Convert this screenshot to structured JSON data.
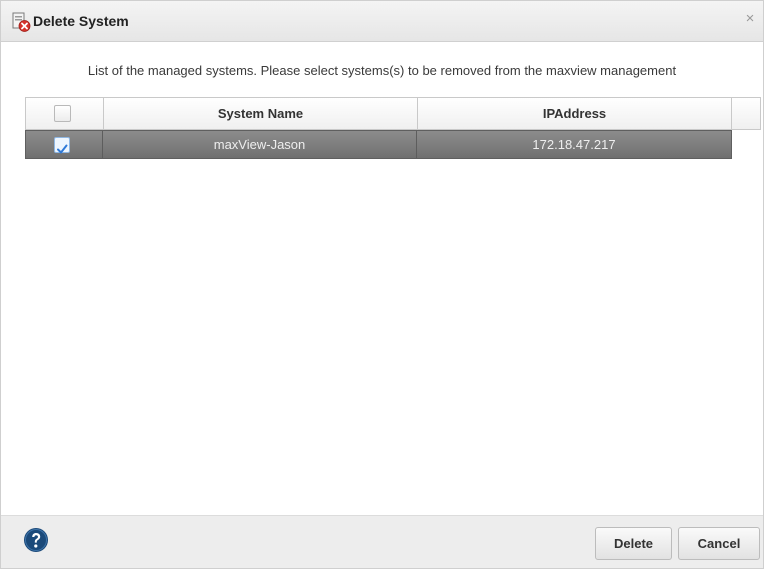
{
  "dialog": {
    "title": "Delete System",
    "close_glyph": "×",
    "instruction": "List of the managed systems. Please select systems(s) to be removed from the maxview management"
  },
  "table": {
    "columns": [
      "",
      "System Name",
      "IPAddress"
    ],
    "rows": [
      {
        "selected": true,
        "system_name": "maxView-Jason",
        "ip_address": "172.18.47.217"
      }
    ]
  },
  "footer": {
    "delete_label": "Delete",
    "cancel_label": "Cancel"
  },
  "icons": {
    "title": "delete-system-icon",
    "close": "close-icon",
    "help": "help-icon",
    "checkbox_checked": "checkmark-icon"
  },
  "colors": {
    "selected_row": "#7b7b7b",
    "help_icon": "#1b4a7a",
    "delete_badge": "#d6322b"
  }
}
